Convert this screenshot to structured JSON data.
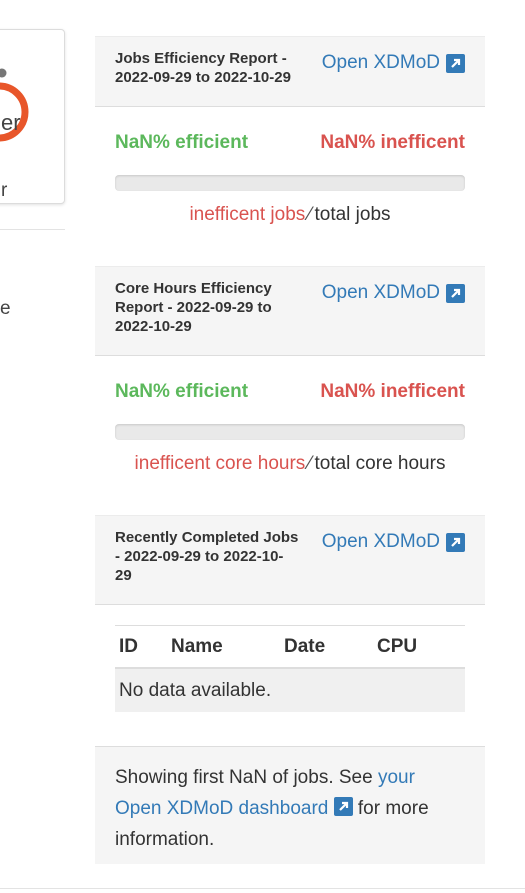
{
  "left": {
    "logo_fragment": "er",
    "user_fragment": "r",
    "text_fragment": "e"
  },
  "jobs_report": {
    "title": "Jobs Efficiency Report - 2022-09-29 to 2022-10-29",
    "title_line1": "Jobs Efficiency Report -",
    "title_line2": "2022-09-29 to 2022-10-29",
    "link_label": "Open XDMoD",
    "efficient_label": "NaN% efficient",
    "inefficient_label": "NaN% inefficent",
    "progress": 0,
    "ratio_numerator": "inefficent jobs",
    "ratio_slash": "⁄",
    "ratio_denominator": "total jobs"
  },
  "core_hours_report": {
    "title_line1": "Core Hours Efficiency",
    "title_line2": "Report - 2022-09-29 to",
    "title_line3": "2022-10-29",
    "link_label": "Open XDMoD",
    "efficient_label": "NaN% efficient",
    "inefficient_label": "NaN% inefficent",
    "progress": 0,
    "ratio_numerator": "inefficent core hours",
    "ratio_slash": "⁄",
    "ratio_denominator": "total core hours"
  },
  "recent_jobs": {
    "title_line1": "Recently Completed Jobs",
    "title_line2": "- 2022-09-29 to 2022-10-",
    "title_line3": "29",
    "link_label": "Open XDMoD",
    "columns": [
      "ID",
      "Name",
      "Date",
      "CPU"
    ],
    "empty_message": "No data available."
  },
  "footer": {
    "prefix": "Showing first NaN of jobs. See ",
    "link_text": "your Open XDMoD dashboard",
    "suffix": " for more information."
  },
  "colors": {
    "link": "#337ab7",
    "success": "#5cb85c",
    "danger": "#d9534f"
  },
  "icons": [
    "external-link-icon"
  ]
}
